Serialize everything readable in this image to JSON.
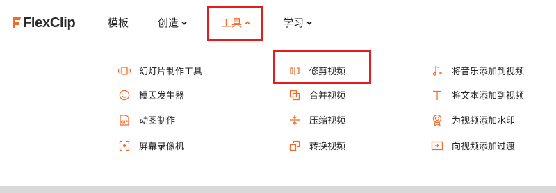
{
  "brand": {
    "logo_text": "FlexClip",
    "accent_color": "#f26b2a"
  },
  "nav": {
    "items": [
      {
        "label": "模板",
        "has_dropdown": false,
        "active": false
      },
      {
        "label": "创造",
        "has_dropdown": true,
        "active": false
      },
      {
        "label": "工具",
        "has_dropdown": true,
        "active": true
      },
      {
        "label": "学习",
        "has_dropdown": true,
        "active": false
      }
    ]
  },
  "tools_menu": {
    "columns": [
      [
        {
          "label": "幻灯片制作工具",
          "icon": "slideshow-icon"
        },
        {
          "label": "模因发生器",
          "icon": "smile-icon"
        },
        {
          "label": "动图制作",
          "icon": "gif-icon"
        },
        {
          "label": "屏幕录像机",
          "icon": "screen-record-icon"
        }
      ],
      [
        {
          "label": "修剪视频",
          "icon": "trim-icon"
        },
        {
          "label": "合并视频",
          "icon": "merge-icon"
        },
        {
          "label": "压缩视频",
          "icon": "compress-icon"
        },
        {
          "label": "转换视频",
          "icon": "convert-icon"
        }
      ],
      [
        {
          "label": "将音乐添加到视频",
          "icon": "music-note-icon"
        },
        {
          "label": "将文本添加到视频",
          "icon": "text-icon"
        },
        {
          "label": "为视频添加水印",
          "icon": "watermark-icon"
        },
        {
          "label": "向视频添加过渡",
          "icon": "transition-icon"
        }
      ]
    ]
  },
  "highlight_color": "#e11d1d"
}
